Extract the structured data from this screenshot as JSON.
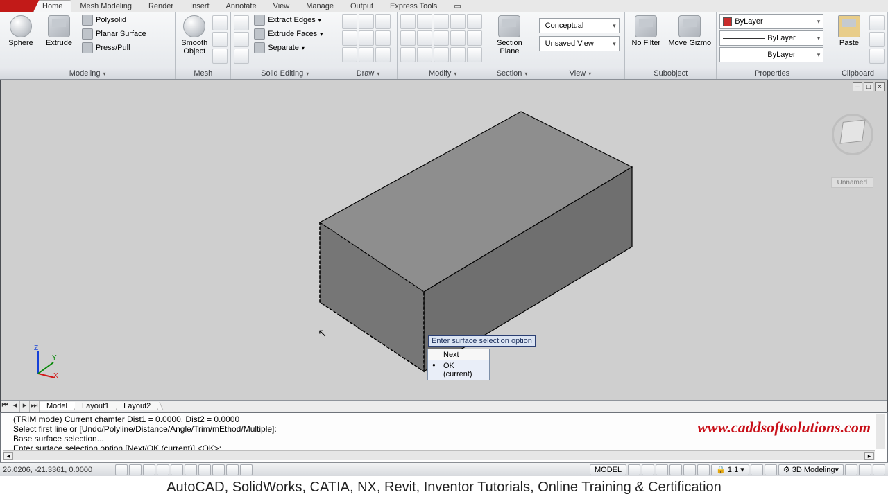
{
  "tabs": {
    "items": [
      "Home",
      "Mesh Modeling",
      "Render",
      "Insert",
      "Annotate",
      "View",
      "Manage",
      "Output",
      "Express Tools"
    ],
    "activeIndex": 0
  },
  "ribbon": {
    "modeling": {
      "label": "Modeling",
      "sphere": "Sphere",
      "extrude": "Extrude",
      "polysolid": "Polysolid",
      "planar": "Planar Surface",
      "presspull": "Press/Pull"
    },
    "mesh": {
      "label": "Mesh",
      "smooth": "Smooth\nObject"
    },
    "solidedit": {
      "label": "Solid Editing",
      "extractEdges": "Extract Edges",
      "extrudeFaces": "Extrude Faces",
      "separate": "Separate"
    },
    "draw": {
      "label": "Draw"
    },
    "modify": {
      "label": "Modify"
    },
    "section": {
      "label": "Section",
      "sectionPlane": "Section\nPlane"
    },
    "view": {
      "label": "View",
      "conceptual": "Conceptual",
      "unsaved": "Unsaved View"
    },
    "subobject": {
      "label": "Subobject",
      "noFilter": "No Filter",
      "moveGizmo": "Move Gizmo"
    },
    "properties": {
      "label": "Properties",
      "byLayer": "ByLayer"
    },
    "clipboard": {
      "label": "Clipboard",
      "paste": "Paste"
    }
  },
  "viewport": {
    "viewcubeLabel": "Unnamed",
    "popupTitle": "Enter surface selection option",
    "popupItems": [
      "Next",
      "OK (current)"
    ],
    "popupSelected": 1
  },
  "layoutTabs": {
    "items": [
      "Model",
      "Layout1",
      "Layout2"
    ],
    "activeIndex": 0
  },
  "command": {
    "lines": [
      "(TRIM mode) Current chamfer Dist1 = 0.0000, Dist2 = 0.0000",
      "Select first line or [Undo/Polyline/Distance/Angle/Trim/mEthod/Multiple]:",
      "Base surface selection...",
      "Enter surface selection option [Next/OK (current)] <OK>:"
    ],
    "watermark": "www.caddsoftsolutions.com"
  },
  "status": {
    "coords": "26.0206, -21.3361, 0.0000",
    "model": "MODEL",
    "scale": "1:1",
    "workspace": "3D Modeling"
  },
  "caption": "AutoCAD, SolidWorks, CATIA, NX, Revit, Inventor Tutorials, Online Training & Certification"
}
